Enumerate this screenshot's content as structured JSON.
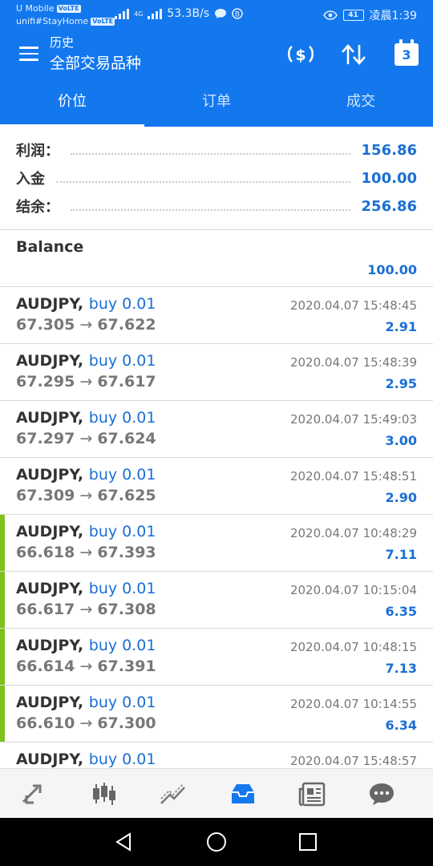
{
  "status_bar": {
    "carrier1": "U Mobile",
    "carrier1_badge": "VoLTE",
    "carrier2": "unifi#StayHome",
    "carrier2_badge": "VoLTE",
    "network": "4G",
    "speed": "53.3B/s",
    "battery": "41",
    "time": "凌晨1:39"
  },
  "header": {
    "title": "历史",
    "subtitle": "全部交易品种",
    "calendar_day": "3"
  },
  "tabs": [
    {
      "label": "价位",
      "active": true
    },
    {
      "label": "订单",
      "active": false
    },
    {
      "label": "成交",
      "active": false
    }
  ],
  "summary": {
    "profit_label": "利润：",
    "profit_value": "156.86",
    "deposit_label": "入金",
    "deposit_value": "100.00",
    "balance_label": "结余：",
    "balance_value": "256.86"
  },
  "balance_entry": {
    "label": "Balance",
    "amount": "100.00"
  },
  "deals": [
    {
      "symbol": "AUDJPY,",
      "type": "buy 0.01",
      "open": "67.305",
      "close": "67.622",
      "time": "2020.04.07 15:48:45",
      "profit": "2.91",
      "marked": false
    },
    {
      "symbol": "AUDJPY,",
      "type": "buy 0.01",
      "open": "67.295",
      "close": "67.617",
      "time": "2020.04.07 15:48:39",
      "profit": "2.95",
      "marked": false
    },
    {
      "symbol": "AUDJPY,",
      "type": "buy 0.01",
      "open": "67.297",
      "close": "67.624",
      "time": "2020.04.07 15:49:03",
      "profit": "3.00",
      "marked": false
    },
    {
      "symbol": "AUDJPY,",
      "type": "buy 0.01",
      "open": "67.309",
      "close": "67.625",
      "time": "2020.04.07 15:48:51",
      "profit": "2.90",
      "marked": false
    },
    {
      "symbol": "AUDJPY,",
      "type": "buy 0.01",
      "open": "66.618",
      "close": "67.393",
      "time": "2020.04.07 10:48:29",
      "profit": "7.11",
      "marked": true
    },
    {
      "symbol": "AUDJPY,",
      "type": "buy 0.01",
      "open": "66.617",
      "close": "67.308",
      "time": "2020.04.07 10:15:04",
      "profit": "6.35",
      "marked": true
    },
    {
      "symbol": "AUDJPY,",
      "type": "buy 0.01",
      "open": "66.614",
      "close": "67.391",
      "time": "2020.04.07 10:48:15",
      "profit": "7.13",
      "marked": true
    },
    {
      "symbol": "AUDJPY,",
      "type": "buy 0.01",
      "open": "66.610",
      "close": "67.300",
      "time": "2020.04.07 10:14:55",
      "profit": "6.34",
      "marked": true
    },
    {
      "symbol": "AUDJPY,",
      "type": "buy 0.01",
      "open": "",
      "close": "",
      "time": "2020.04.07 15:48:57",
      "profit": "",
      "marked": false
    }
  ],
  "bottom_nav": [
    {
      "icon": "quotes-icon",
      "active": false
    },
    {
      "icon": "chart-icon",
      "active": false
    },
    {
      "icon": "trade-icon",
      "active": false
    },
    {
      "icon": "history-icon",
      "active": true
    },
    {
      "icon": "news-icon",
      "active": false
    },
    {
      "icon": "messages-icon",
      "active": false
    }
  ],
  "colors": {
    "primary": "#1378ee",
    "accent_text": "#1a6fd6",
    "marker": "#7cc11d"
  }
}
